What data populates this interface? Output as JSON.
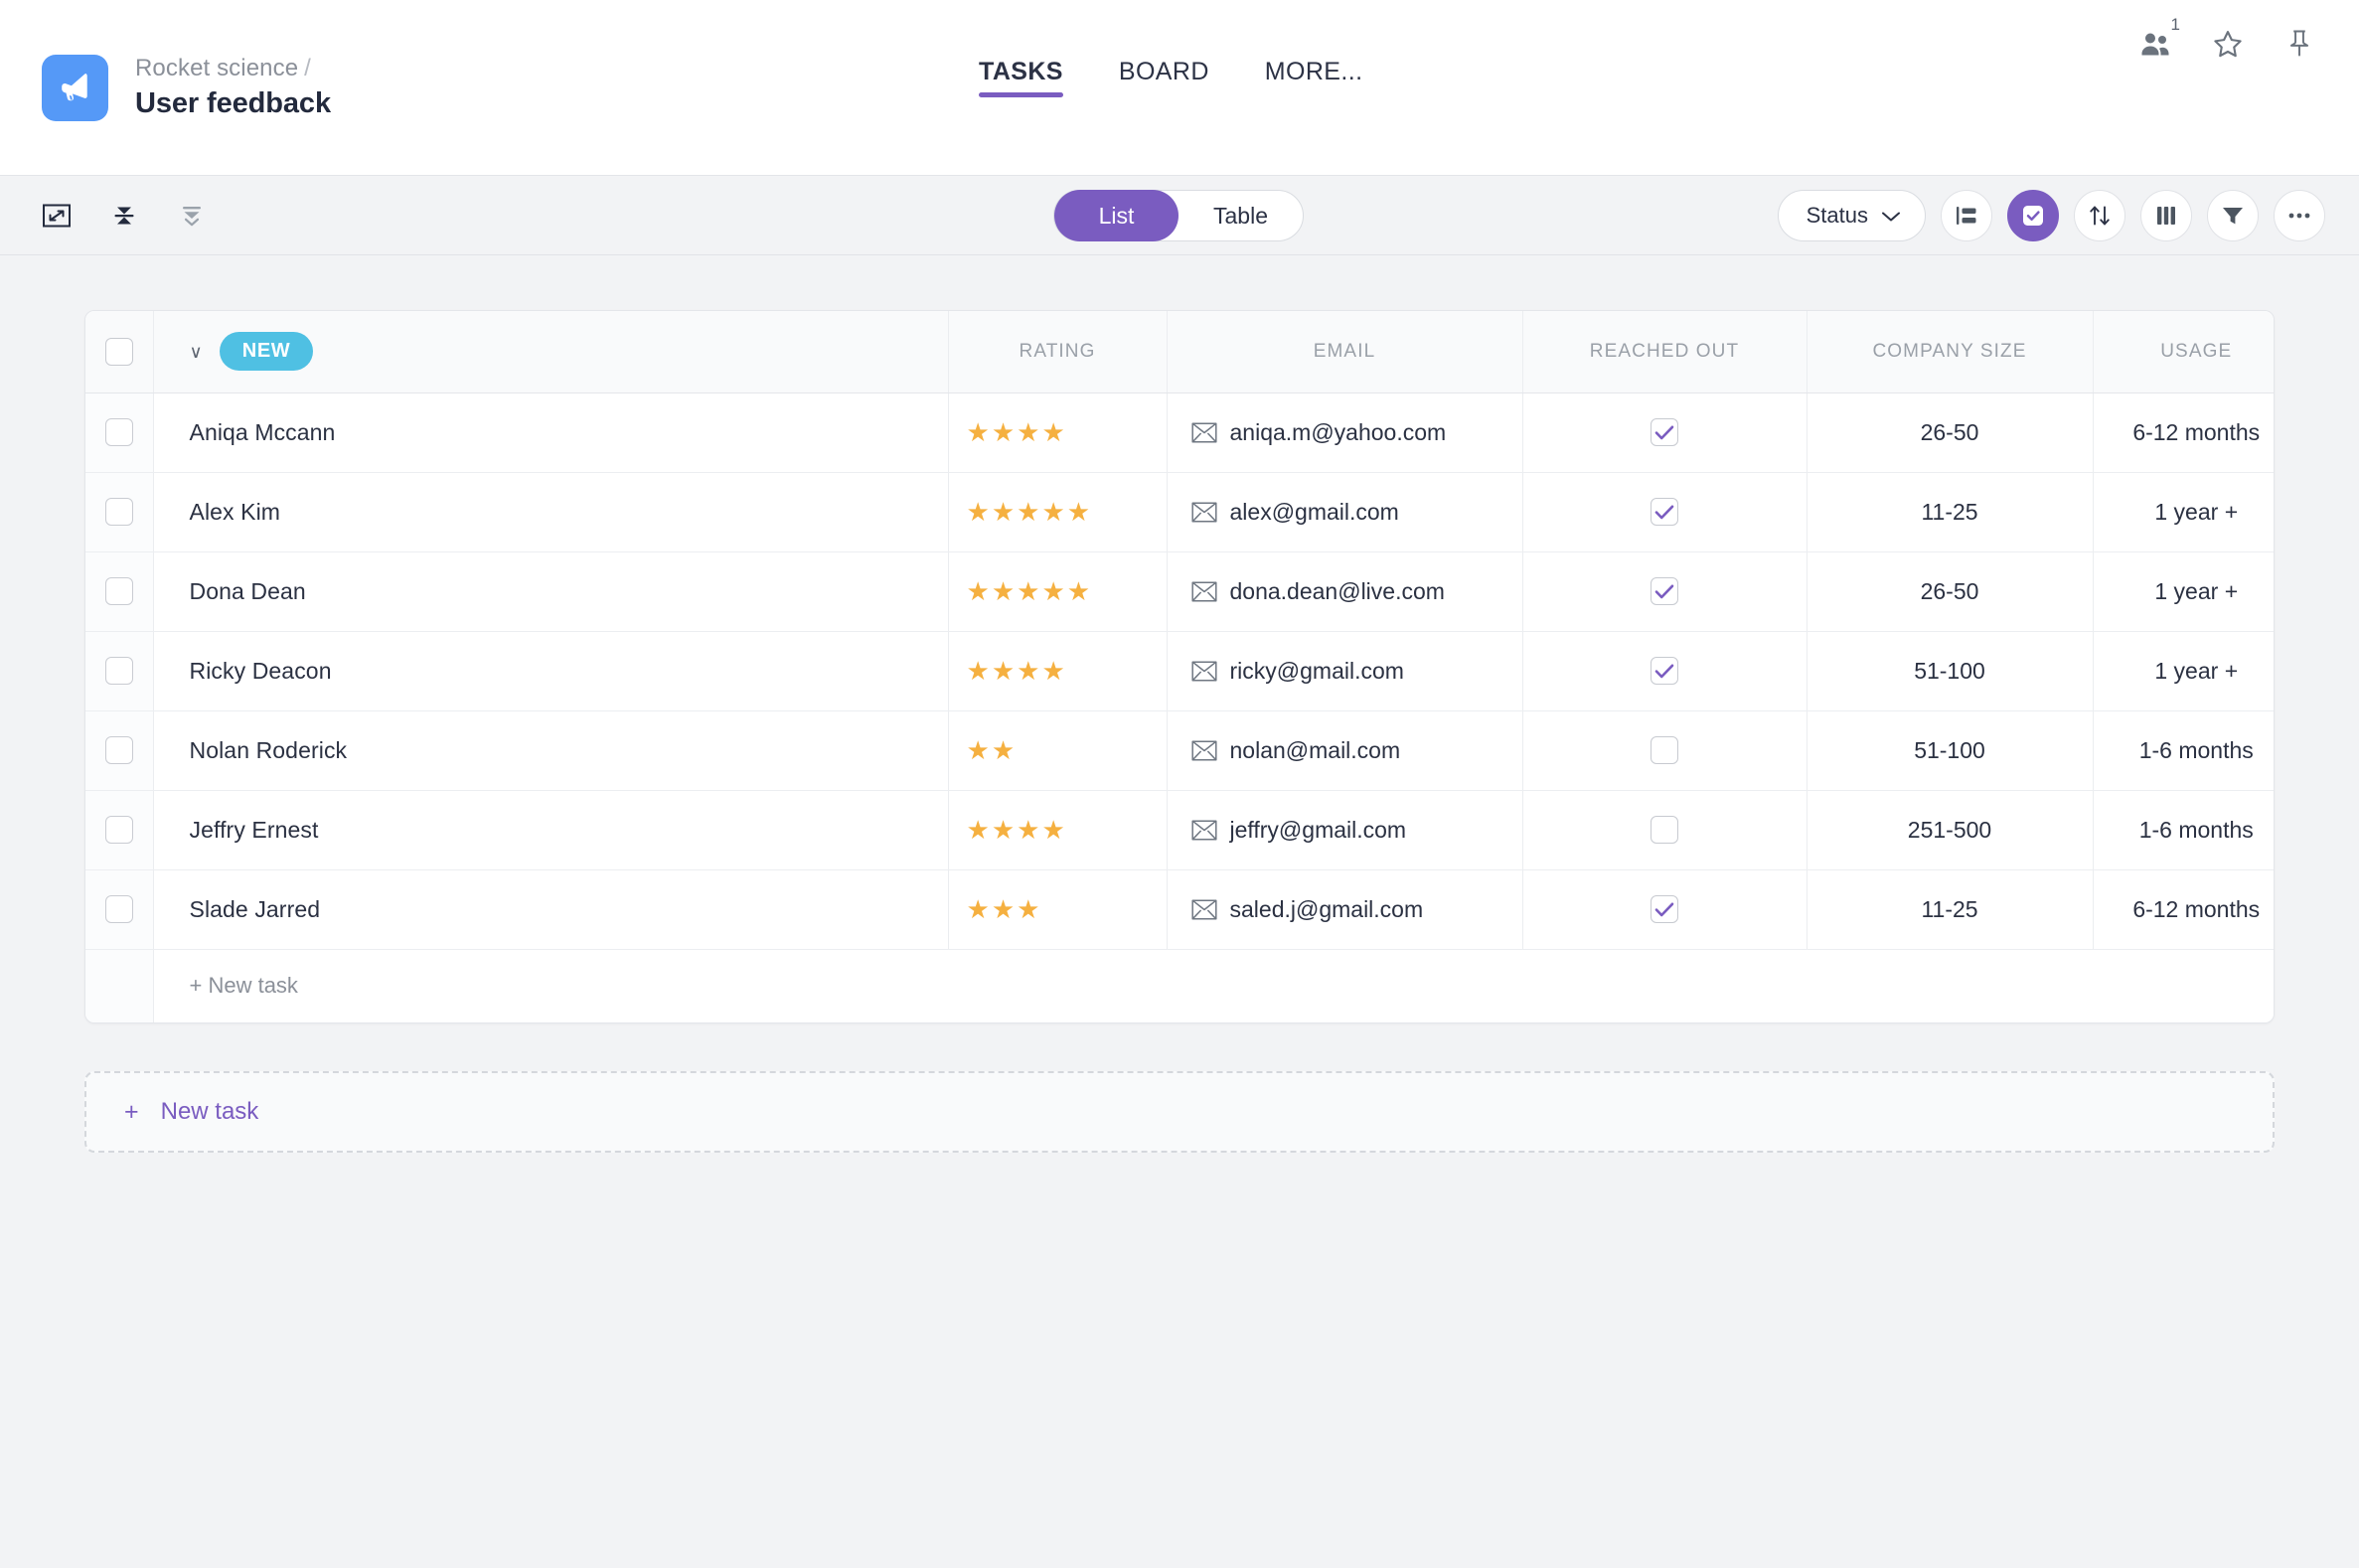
{
  "header": {
    "logo_icon": "megaphone-icon",
    "breadcrumb_parent": "Rocket science",
    "breadcrumb_separator": "/",
    "title": "User feedback",
    "tabs": [
      {
        "label": "TASKS",
        "active": true
      },
      {
        "label": "BOARD",
        "active": false
      },
      {
        "label": "MORE...",
        "active": false
      }
    ],
    "right_icons": [
      {
        "name": "members-icon",
        "badge": "1"
      },
      {
        "name": "star-icon",
        "badge": ""
      },
      {
        "name": "pin-icon",
        "badge": ""
      }
    ]
  },
  "toolbar": {
    "left_icons": [
      {
        "name": "fullscreen-icon"
      },
      {
        "name": "collapse-rows-icon"
      },
      {
        "name": "expand-rows-icon"
      }
    ],
    "view_toggle": {
      "options": [
        {
          "label": "List",
          "active": true
        },
        {
          "label": "Table",
          "active": false
        }
      ]
    },
    "status_dropdown": {
      "label": "Status",
      "chevron_icon": "chevron-down-icon"
    },
    "right_icons": [
      {
        "name": "group-by-icon",
        "filled": false
      },
      {
        "name": "checkbox-check-icon",
        "filled": true
      },
      {
        "name": "sort-icon",
        "filled": false
      },
      {
        "name": "columns-icon",
        "filled": false
      },
      {
        "name": "filter-icon",
        "filled": false
      },
      {
        "name": "more-options-icon",
        "filled": false
      }
    ]
  },
  "table": {
    "group_caret_icon": "chevron-down-icon",
    "group_badge": "NEW",
    "columns": [
      {
        "key": "rating",
        "label": "RATING"
      },
      {
        "key": "email",
        "label": "EMAIL"
      },
      {
        "key": "reached_out",
        "label": "REACHED OUT"
      },
      {
        "key": "company_size",
        "label": "COMPANY SIZE"
      },
      {
        "key": "usage",
        "label": "USAGE"
      }
    ],
    "rows": [
      {
        "name": "Aniqa Mccann",
        "rating": 4,
        "email": "aniqa.m@yahoo.com",
        "reached_out": true,
        "company_size": "26-50",
        "usage": "6-12 months",
        "selected": false
      },
      {
        "name": "Alex Kim",
        "rating": 5,
        "email": "alex@gmail.com",
        "reached_out": true,
        "company_size": "11-25",
        "usage": "1 year +",
        "selected": false
      },
      {
        "name": "Dona Dean",
        "rating": 5,
        "email": "dona.dean@live.com",
        "reached_out": true,
        "company_size": "26-50",
        "usage": "1 year +",
        "selected": false
      },
      {
        "name": "Ricky Deacon",
        "rating": 4,
        "email": "ricky@gmail.com",
        "reached_out": true,
        "company_size": "51-100",
        "usage": "1 year +",
        "selected": false
      },
      {
        "name": "Nolan Roderick",
        "rating": 2,
        "email": "nolan@mail.com",
        "reached_out": false,
        "company_size": "51-100",
        "usage": "1-6 months",
        "selected": false
      },
      {
        "name": "Jeffry Ernest",
        "rating": 4,
        "email": "jeffry@gmail.com",
        "reached_out": false,
        "company_size": "251-500",
        "usage": "1-6 months",
        "selected": false
      },
      {
        "name": "Slade Jarred",
        "rating": 3,
        "email": "saled.j@gmail.com",
        "reached_out": true,
        "company_size": "11-25",
        "usage": "6-12 months",
        "selected": false
      }
    ],
    "inline_new_task_label": "+ New task"
  },
  "footer": {
    "new_task_plus": "+",
    "new_task_label": "New task"
  },
  "colors": {
    "accent_purple": "#7a5cc0",
    "badge_blue": "#4fc0e3",
    "logo_blue": "#5599f7",
    "star_orange": "#f5b040",
    "page_bg": "#f2f3f5"
  }
}
